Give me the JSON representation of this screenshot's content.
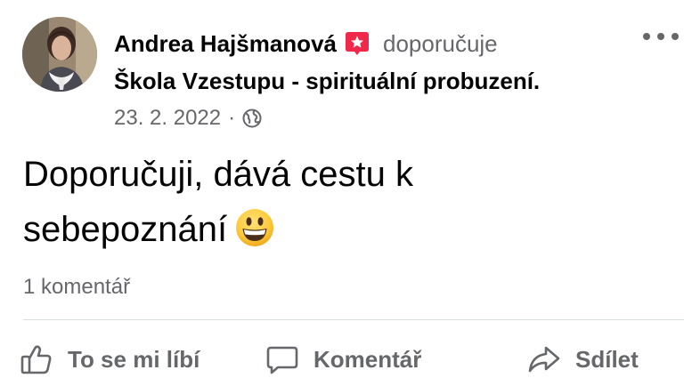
{
  "post": {
    "author_name": "Andrea Hajšmanová",
    "recommend_verb": "doporučuje",
    "page_name": "Škola Vzestupu - spirituální probuzení.",
    "date": "23. 2. 2022",
    "separator": "·",
    "privacy_icon": "globe-icon",
    "recommend_icon": "recommendation-star-icon",
    "more_icon": "more-options-icon",
    "text_line1": "Doporučuji, dává cestu k",
    "text_line2": "sebepoznání",
    "emoji": "grinning-face-emoji",
    "comments_count": "1 komentář"
  },
  "actions": {
    "like_label": "To se mi líbí",
    "like_icon": "thumbs-up-icon",
    "comment_label": "Komentář",
    "comment_icon": "comment-bubble-icon",
    "share_label": "Sdílet",
    "share_icon": "share-arrow-icon"
  },
  "colors": {
    "primary_text": "#050505",
    "secondary_text": "#65676b",
    "recommend_badge": "#f02849",
    "divider": "#dadde1"
  }
}
